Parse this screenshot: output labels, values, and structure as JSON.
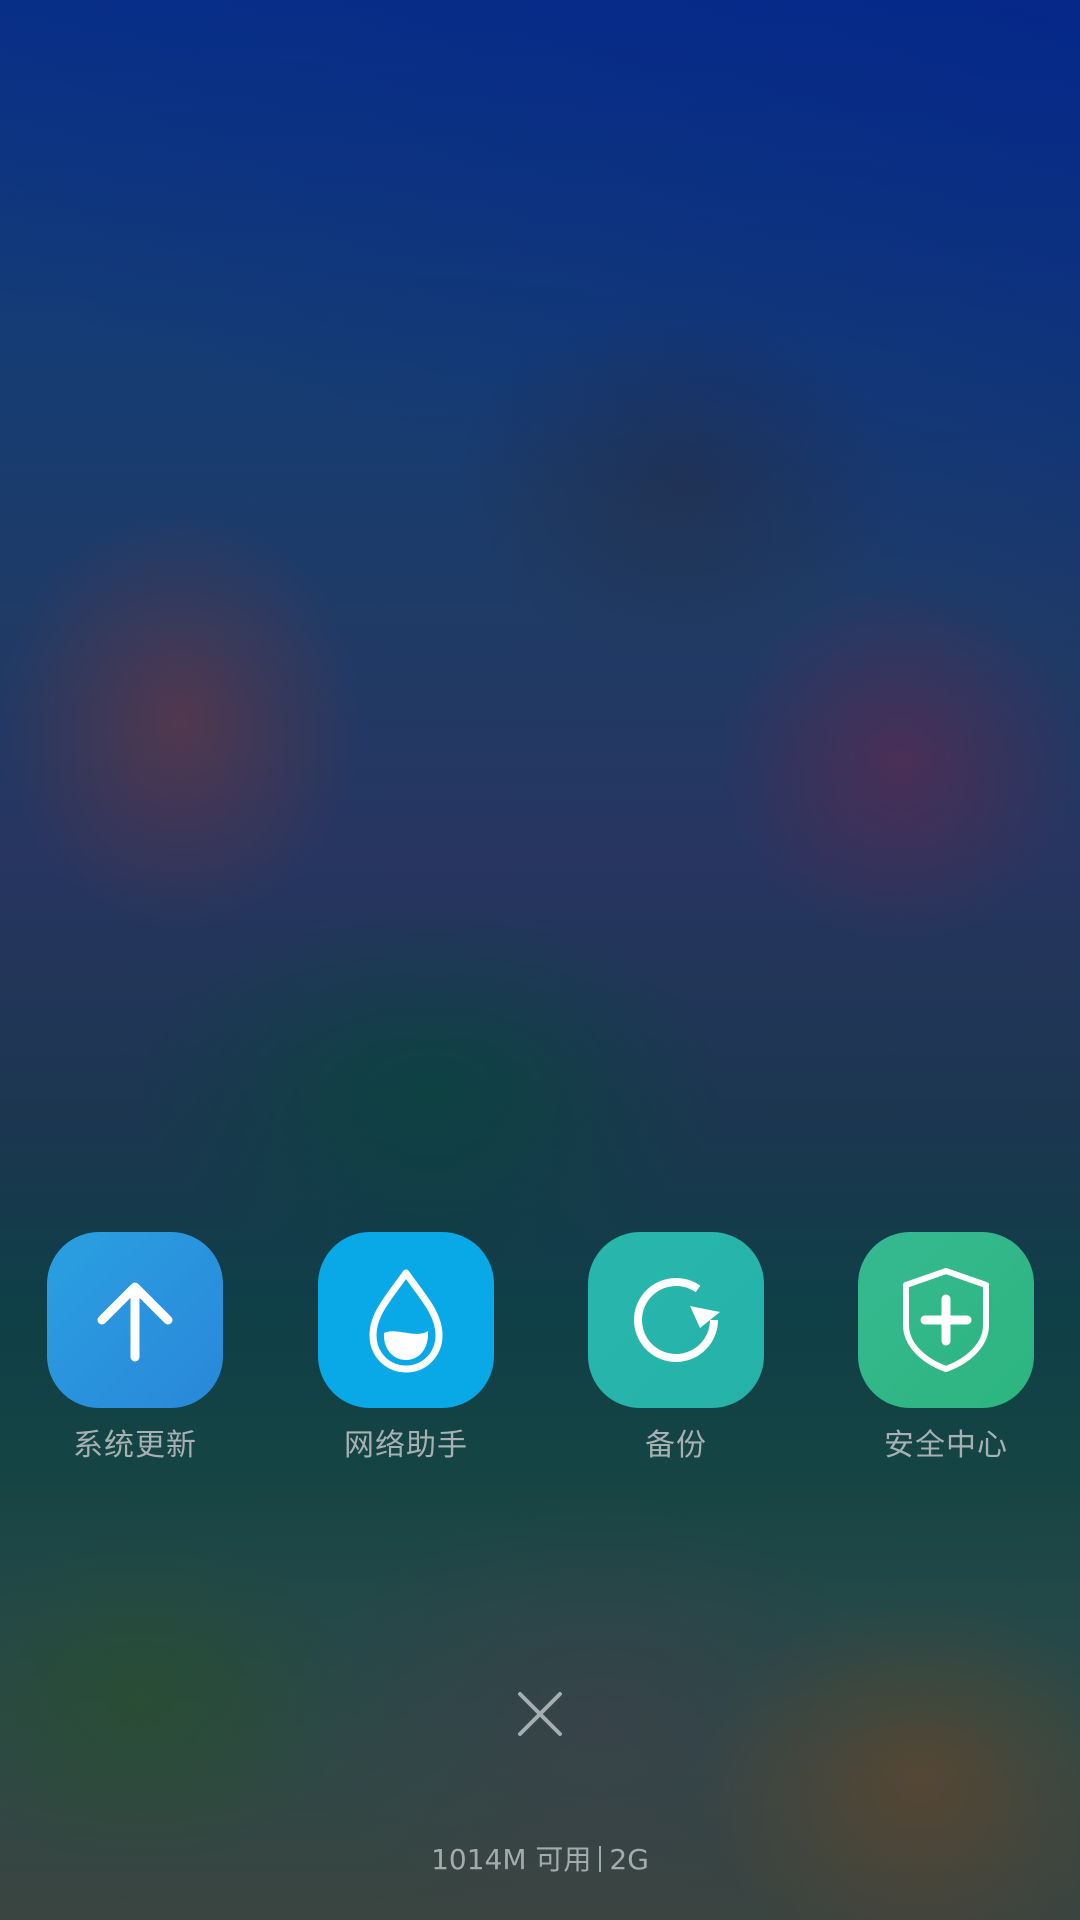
{
  "shortcuts": [
    {
      "label": "系统更新",
      "icon": "arrow-up-icon",
      "color_from": "#2aa0e2",
      "color_to": "#2a87d9"
    },
    {
      "label": "网络助手",
      "icon": "water-drop-icon",
      "color_from": "#08a9e6",
      "color_to": "#08a9e6"
    },
    {
      "label": "备份",
      "icon": "refresh-circle-icon",
      "color_from": "#29b7ad",
      "color_to": "#25b2a8"
    },
    {
      "label": "安全中心",
      "icon": "shield-plus-icon",
      "color_from": "#36b991",
      "color_to": "#2db57f"
    }
  ],
  "close": {
    "icon": "close-icon"
  },
  "memory": {
    "available": "1014M 可用",
    "total": "2G"
  }
}
